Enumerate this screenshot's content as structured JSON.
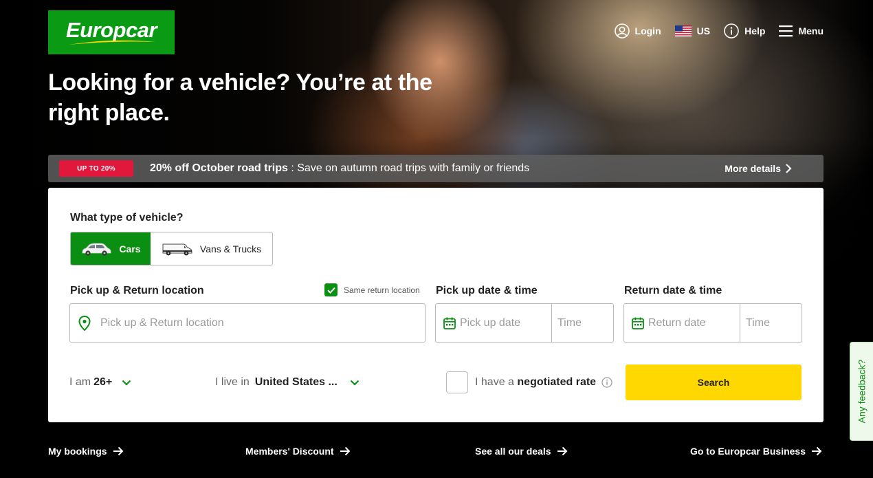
{
  "brand": {
    "name": "Europcar",
    "accent": "#0a8f12",
    "logo_bg": "#0a9a14",
    "swoosh": "#fed800"
  },
  "nav": {
    "login": "Login",
    "country": "US",
    "help": "Help",
    "menu": "Menu",
    "icons": {
      "login": "user-circle-icon",
      "country": "us-flag-icon",
      "help": "info-circle-icon",
      "menu": "hamburger-icon"
    }
  },
  "hero": {
    "headline": "Looking for a vehicle? You’re at the right place."
  },
  "promo": {
    "badge": "UP TO 20%",
    "badge_color": "#e2173c",
    "title": "20% off October road trips",
    "description": " : Save on autumn road trips with family or friends",
    "more": "More details"
  },
  "booking": {
    "vehicle_type_label": "What type of vehicle?",
    "vehicle_types": [
      {
        "label": "Cars",
        "selected": true,
        "icon": "car-icon"
      },
      {
        "label": "Vans & Trucks",
        "selected": false,
        "icon": "van-icon"
      }
    ],
    "location_label": "Pick up & Return location",
    "same_return_label": "Same return location",
    "same_return_checked": true,
    "location_placeholder": "Pick up & Return location",
    "pickup_label": "Pick up date & time",
    "pickup_date_placeholder": "Pick up date",
    "pickup_time_placeholder": "Time",
    "return_label": "Return date & time",
    "return_date_placeholder": "Return date",
    "return_time_placeholder": "Time",
    "age_prefix": "I am",
    "age_value": "26+",
    "live_prefix": "I live in",
    "live_value": "United States ...",
    "negotiated_prefix": "I have a",
    "negotiated_strong": "negotiated rate",
    "search": "Search",
    "search_color": "#fed800"
  },
  "footer_links": [
    "My bookings",
    "Members' Discount",
    "See all our deals",
    "Go to Europcar Business"
  ],
  "feedback": "Any feedback?"
}
